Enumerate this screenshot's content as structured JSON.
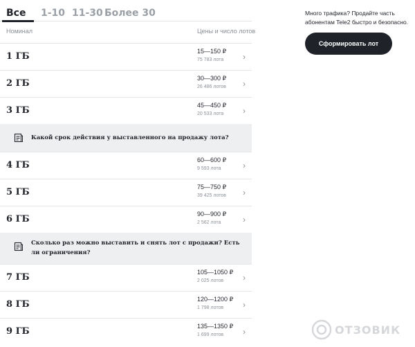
{
  "tabs": [
    {
      "label": "Все"
    },
    {
      "label": "1-10"
    },
    {
      "label": "11-30"
    },
    {
      "label": "Более 30"
    }
  ],
  "columns": {
    "nominal": "Номинал",
    "prices": "Цены и число лотов"
  },
  "rows": [
    {
      "title": "1 ГБ",
      "price": "15—150 ₽",
      "lots": "75 783 лота"
    },
    {
      "title": "2 ГБ",
      "price": "30—300 ₽",
      "lots": "26 486 лотов"
    },
    {
      "title": "3 ГБ",
      "price": "45—450 ₽",
      "lots": "20 533 лота"
    },
    {
      "title": "4 ГБ",
      "price": "60—600 ₽",
      "lots": "9 593 лота"
    },
    {
      "title": "5 ГБ",
      "price": "75—750 ₽",
      "lots": "39 425 лотов"
    },
    {
      "title": "6 ГБ",
      "price": "90—900 ₽",
      "lots": "2 562 лота"
    },
    {
      "title": "7 ГБ",
      "price": "105—1050 ₽",
      "lots": "2 025 лотов"
    },
    {
      "title": "8 ГБ",
      "price": "120—1200 ₽",
      "lots": "1 798 лотов"
    },
    {
      "title": "9 ГБ",
      "price": "135—1350 ₽",
      "lots": "1 699 лотов"
    }
  ],
  "faq": [
    {
      "text": "Какой срок действия у выставленного на продажу лота?"
    },
    {
      "text": "Сколько раз можно выставить и снять лот с продажи? Есть ли ограничения?"
    }
  ],
  "sidebar": {
    "text": "Много трафика? Продайте часть абонентам Tele2 быстро и безопасно.",
    "button_label": "Сформировать лот"
  },
  "watermark": {
    "text": "ОТЗОВИК"
  },
  "colors": {
    "text": "#1f2229",
    "muted": "#8a8f96",
    "divider": "#e3e5e8",
    "faq_bg": "#eeeff1",
    "button_bg": "#1f2229"
  }
}
